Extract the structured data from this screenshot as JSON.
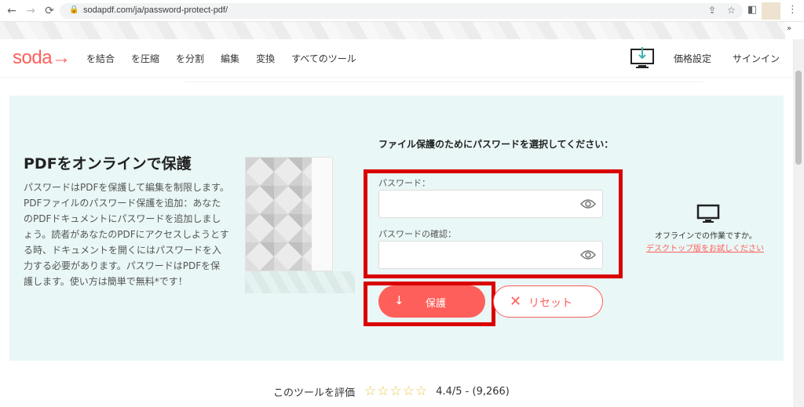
{
  "browser": {
    "url": "sodapdf.com/ja/password-protect-pdf/",
    "back_icon": "←",
    "forward_icon": "→",
    "reload_icon": "⟳",
    "share_icon": "⇪",
    "star_icon": "☆",
    "sidepanel_icon": "◧",
    "menu_icon": "⋮",
    "chevrons": "»"
  },
  "header": {
    "logo": "soda→",
    "menu": [
      "を結合",
      "を圧縮",
      "を分割",
      "編集",
      "変換",
      "すべてのツール"
    ],
    "pricing": "価格設定",
    "signin": "サインイン"
  },
  "hero": {
    "title": "PDFをオンラインで保護",
    "description": "パスワードはPDFを保護して編集を制限します。PDFファイルのパスワード保護を追加：あなたのPDFドキュメントにパスワードを追加しましょう。読者があなたのPDFにアクセスしようとする時、ドキュメントを開くにはパスワードを入力する必要があります。パスワードはPDFを保護します。使い方は簡単で無料*です！"
  },
  "form": {
    "heading": "ファイル保護のためにパスワードを選択してください：",
    "password_label": "パスワード：",
    "confirm_label": "パスワードの確認：",
    "password_value": "",
    "confirm_value": "",
    "protect_label": "保護",
    "reset_label": "リセット"
  },
  "offline": {
    "text": "オフラインでの作業ですか。",
    "link": "デスクトップ版をお試しください"
  },
  "rating": {
    "label": "このツールを評価",
    "stars": "☆☆☆☆☆",
    "score": "4.4/5 - (9,266)"
  },
  "colors": {
    "accent": "#ff5f5a",
    "panel": "#e9f7f6",
    "highlight": "#d90000"
  }
}
